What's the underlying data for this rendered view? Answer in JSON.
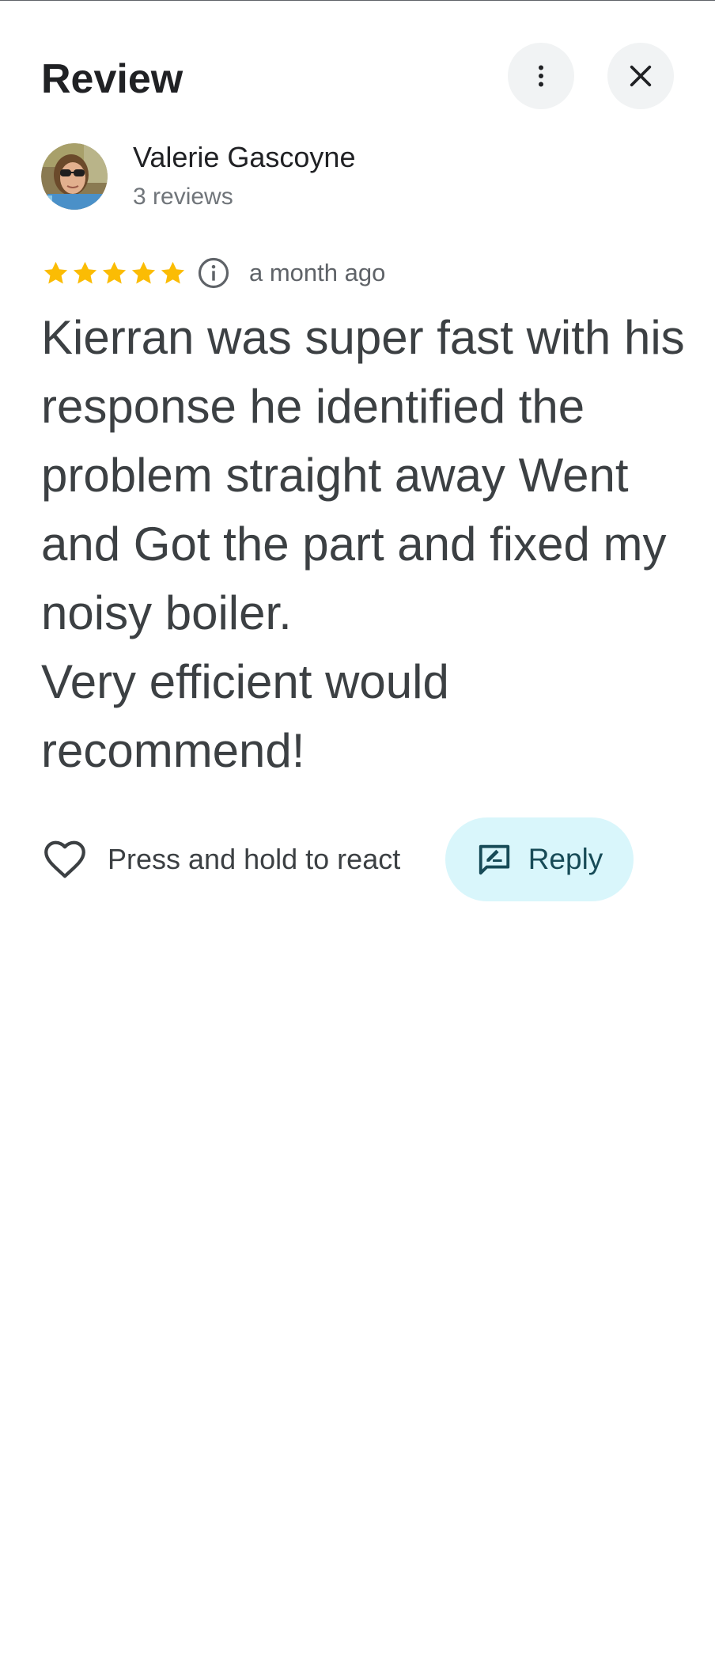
{
  "header": {
    "title": "Review",
    "more_icon": "more-vert-icon",
    "close_icon": "close-icon"
  },
  "reviewer": {
    "name": "Valerie Gascoyne",
    "review_count": "3 reviews",
    "avatar_icon": "avatar-photo"
  },
  "rating": {
    "stars": 5,
    "max_stars": 5,
    "star_color": "#fbbc04",
    "info_icon": "info-icon",
    "time_ago": "a month ago"
  },
  "review": {
    "text": "Kierran was super fast with his response he identified the problem straight away Went and Got the part and fixed my noisy boiler.\nVery efficient would recommend!"
  },
  "actions": {
    "react_label": "Press and hold to react",
    "react_icon": "heart-outline-icon",
    "reply_label": "Reply",
    "reply_icon": "rate-review-icon",
    "reply_bg": "#d9f6fb",
    "reply_color": "#174b57"
  }
}
